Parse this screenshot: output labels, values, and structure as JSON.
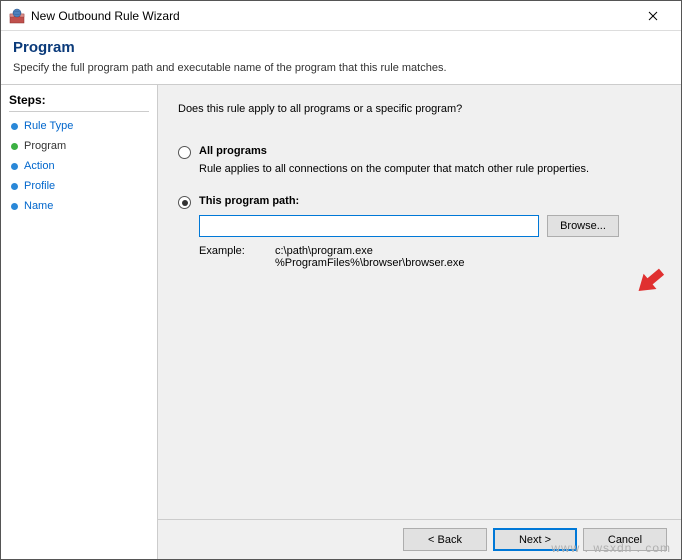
{
  "titlebar": {
    "title": "New Outbound Rule Wizard"
  },
  "header": {
    "title": "Program",
    "description": "Specify the full program path and executable name of the program that this rule matches."
  },
  "sidebar": {
    "steps_label": "Steps:",
    "items": [
      {
        "label": "Rule Type"
      },
      {
        "label": "Program"
      },
      {
        "label": "Action"
      },
      {
        "label": "Profile"
      },
      {
        "label": "Name"
      }
    ]
  },
  "main": {
    "question": "Does this rule apply to all programs or a specific program?",
    "opt_all": {
      "label": "All programs",
      "desc": "Rule applies to all connections on the computer that match other rule properties."
    },
    "opt_path": {
      "label": "This program path:",
      "value": "",
      "browse": "Browse...",
      "example_label": "Example:",
      "example_text": "c:\\path\\program.exe\n%ProgramFiles%\\browser\\browser.exe"
    }
  },
  "footer": {
    "back": "< Back",
    "next": "Next >",
    "cancel": "Cancel"
  },
  "watermark": "www . wsxdn . com"
}
